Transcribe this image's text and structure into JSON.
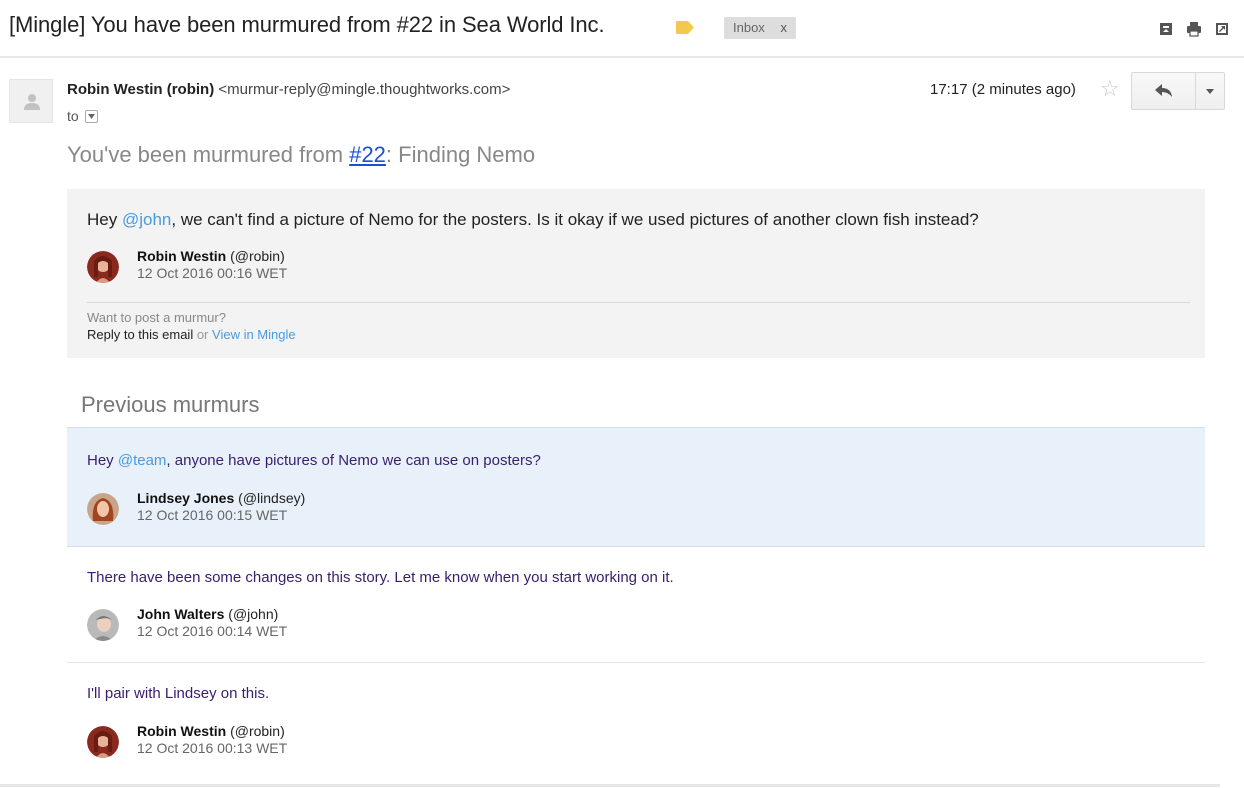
{
  "subject": {
    "title": "[Mingle] You have been murmured from #22 in Sea World Inc.",
    "label_color": "#f2c94c",
    "inbox_chip": "Inbox",
    "inbox_chip_close": "x",
    "icons": [
      "archive-icon",
      "print-icon",
      "new-window-icon"
    ]
  },
  "message": {
    "sender_name": "Robin Westin (robin)",
    "sender_email": "<murmur-reply@mingle.thoughtworks.com>",
    "to_label": "to",
    "time": "17:17 (2 minutes ago)",
    "star": "☆"
  },
  "email": {
    "heading_prefix": "You've been murmured from ",
    "heading_link": "#22",
    "heading_suffix": ": Finding Nemo",
    "murmur": {
      "text_before": "Hey ",
      "mention": "@john",
      "text_after": ", we can't find a picture of Nemo for the posters. Is it okay if we used pictures of another clown fish instead?",
      "author_name": "Robin Westin",
      "author_handle": "(@robin)",
      "date": "12 Oct 2016 00:16 WET"
    },
    "want_post": "Want to post a murmur?",
    "reply_text": "Reply to this email",
    "or_text": " or ",
    "view_link": "View in Mingle"
  },
  "previous": {
    "heading": "Previous murmurs",
    "items": [
      {
        "text_before": "Hey ",
        "mention": "@team",
        "text_after": ", anyone have pictures of Nemo we can use on posters?",
        "author_name": "Lindsey Jones",
        "author_handle": "(@lindsey)",
        "date": "12 Oct 2016 00:15 WET"
      },
      {
        "text": "There have been some changes on this story. Let me know when you start working on it.",
        "author_name": "John Walters",
        "author_handle": "(@john)",
        "date": "12 Oct 2016 00:14 WET"
      },
      {
        "text": "I'll pair with Lindsey on this.",
        "author_name": "Robin Westin",
        "author_handle": "(@robin)",
        "date": "12 Oct 2016 00:13 WET"
      }
    ]
  },
  "colors": {
    "mention": "#4a9ae0",
    "link": "#1a4fd6",
    "highlight_bg": "#e8f1fa",
    "murmur_bg": "#f3f3f3",
    "prev_text": "#3a1d6e"
  }
}
